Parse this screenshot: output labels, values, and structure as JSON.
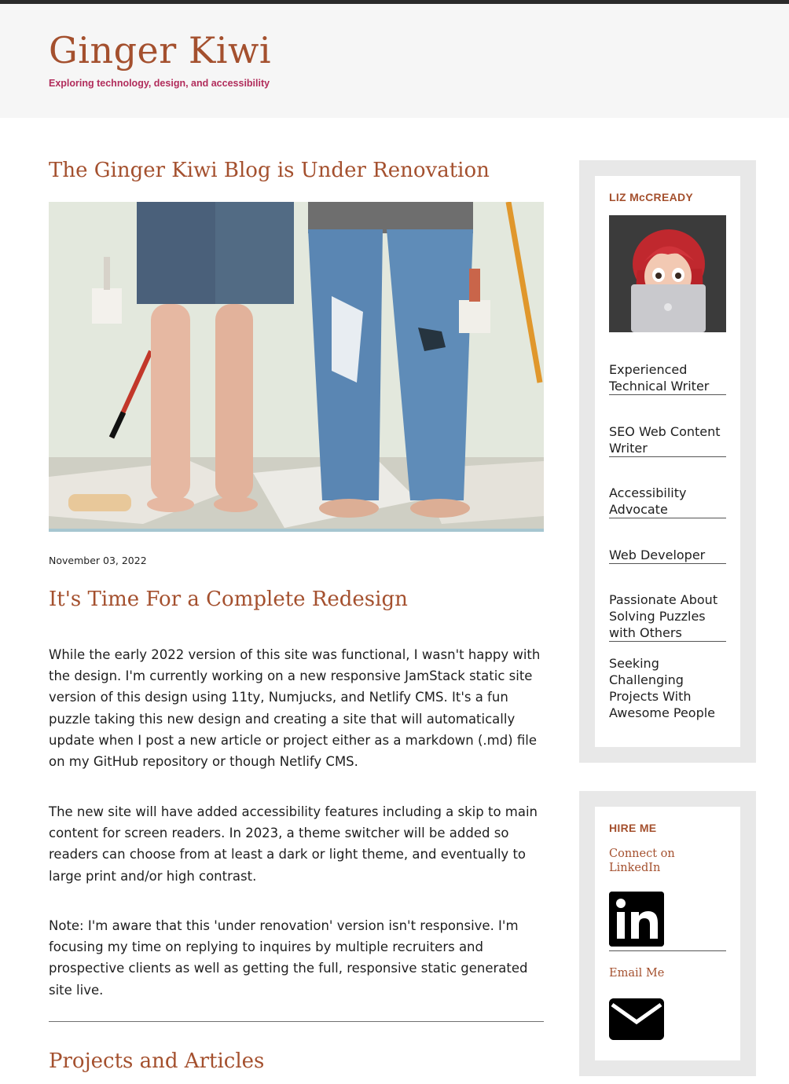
{
  "site": {
    "title": "Ginger Kiwi",
    "tagline": "Exploring technology, design, and accessibility"
  },
  "post": {
    "title": "The Ginger Kiwi Blog is Under Renovation",
    "date": "November 03, 2022",
    "section_title": "It's Time For a Complete Redesign",
    "paragraphs": [
      "While the early 2022 version of this site was functional, I wasn't happy with the design. I'm currently working on a new responsive JamStack static site version of this design using 11ty, Numjucks, and Netlify CMS. It's a fun puzzle taking this new design and creating a site that will automatically update when I post a new article or project either as a markdown (.md) file on my GitHub repository or though Netlify CMS.",
      "The new site will have added accessibility features including a skip to main content for screen readers. In 2023, a theme switcher will be added so readers can choose from at least a dark or light theme, and eventually to large print and/or high contrast.",
      "Note: I'm aware that this 'under renovation' version isn't responsive. I'm focusing my time on replying to inquires by multiple recruiters and prospective clients as well as getting the full, responsive static generated site live."
    ]
  },
  "projects": {
    "title": "Projects and Articles"
  },
  "sidebar": {
    "profile": {
      "name": "LIZ McCREADY",
      "skills": [
        "Experienced Technical Writer",
        "SEO Web Content Writer",
        "Accessibility Advocate",
        "Web Developer",
        "Passionate About Solving Puzzles with Others",
        "Seeking Challenging Projects With Awesome People"
      ]
    },
    "hire": {
      "heading": "HIRE ME",
      "linkedin_label": "Connect on LinkedIn",
      "email_label": "Email Me"
    }
  },
  "icons": {
    "linkedin": "linkedin-icon",
    "email": "envelope-icon"
  },
  "colors": {
    "accent": "#a4502e",
    "tagline": "#b12c5b",
    "header_bg": "#f6f6f6",
    "sidebar_bg": "#e8e8e8"
  }
}
